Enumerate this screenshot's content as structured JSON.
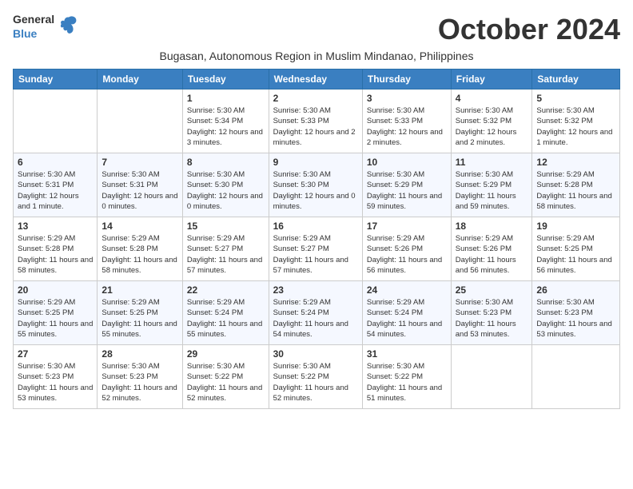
{
  "logo": {
    "general": "General",
    "blue": "Blue"
  },
  "title": "October 2024",
  "subtitle": "Bugasan, Autonomous Region in Muslim Mindanao, Philippines",
  "days_of_week": [
    "Sunday",
    "Monday",
    "Tuesday",
    "Wednesday",
    "Thursday",
    "Friday",
    "Saturday"
  ],
  "weeks": [
    [
      {
        "day": null,
        "info": null
      },
      {
        "day": null,
        "info": null
      },
      {
        "day": "1",
        "sunrise": "5:30 AM",
        "sunset": "5:34 PM",
        "daylight": "12 hours and 3 minutes."
      },
      {
        "day": "2",
        "sunrise": "5:30 AM",
        "sunset": "5:33 PM",
        "daylight": "12 hours and 2 minutes."
      },
      {
        "day": "3",
        "sunrise": "5:30 AM",
        "sunset": "5:33 PM",
        "daylight": "12 hours and 2 minutes."
      },
      {
        "day": "4",
        "sunrise": "5:30 AM",
        "sunset": "5:32 PM",
        "daylight": "12 hours and 2 minutes."
      },
      {
        "day": "5",
        "sunrise": "5:30 AM",
        "sunset": "5:32 PM",
        "daylight": "12 hours and 1 minute."
      }
    ],
    [
      {
        "day": "6",
        "sunrise": "5:30 AM",
        "sunset": "5:31 PM",
        "daylight": "12 hours and 1 minute."
      },
      {
        "day": "7",
        "sunrise": "5:30 AM",
        "sunset": "5:31 PM",
        "daylight": "12 hours and 0 minutes."
      },
      {
        "day": "8",
        "sunrise": "5:30 AM",
        "sunset": "5:30 PM",
        "daylight": "12 hours and 0 minutes."
      },
      {
        "day": "9",
        "sunrise": "5:30 AM",
        "sunset": "5:30 PM",
        "daylight": "12 hours and 0 minutes."
      },
      {
        "day": "10",
        "sunrise": "5:30 AM",
        "sunset": "5:29 PM",
        "daylight": "11 hours and 59 minutes."
      },
      {
        "day": "11",
        "sunrise": "5:30 AM",
        "sunset": "5:29 PM",
        "daylight": "11 hours and 59 minutes."
      },
      {
        "day": "12",
        "sunrise": "5:29 AM",
        "sunset": "5:28 PM",
        "daylight": "11 hours and 58 minutes."
      }
    ],
    [
      {
        "day": "13",
        "sunrise": "5:29 AM",
        "sunset": "5:28 PM",
        "daylight": "11 hours and 58 minutes."
      },
      {
        "day": "14",
        "sunrise": "5:29 AM",
        "sunset": "5:28 PM",
        "daylight": "11 hours and 58 minutes."
      },
      {
        "day": "15",
        "sunrise": "5:29 AM",
        "sunset": "5:27 PM",
        "daylight": "11 hours and 57 minutes."
      },
      {
        "day": "16",
        "sunrise": "5:29 AM",
        "sunset": "5:27 PM",
        "daylight": "11 hours and 57 minutes."
      },
      {
        "day": "17",
        "sunrise": "5:29 AM",
        "sunset": "5:26 PM",
        "daylight": "11 hours and 56 minutes."
      },
      {
        "day": "18",
        "sunrise": "5:29 AM",
        "sunset": "5:26 PM",
        "daylight": "11 hours and 56 minutes."
      },
      {
        "day": "19",
        "sunrise": "5:29 AM",
        "sunset": "5:25 PM",
        "daylight": "11 hours and 56 minutes."
      }
    ],
    [
      {
        "day": "20",
        "sunrise": "5:29 AM",
        "sunset": "5:25 PM",
        "daylight": "11 hours and 55 minutes."
      },
      {
        "day": "21",
        "sunrise": "5:29 AM",
        "sunset": "5:25 PM",
        "daylight": "11 hours and 55 minutes."
      },
      {
        "day": "22",
        "sunrise": "5:29 AM",
        "sunset": "5:24 PM",
        "daylight": "11 hours and 55 minutes."
      },
      {
        "day": "23",
        "sunrise": "5:29 AM",
        "sunset": "5:24 PM",
        "daylight": "11 hours and 54 minutes."
      },
      {
        "day": "24",
        "sunrise": "5:29 AM",
        "sunset": "5:24 PM",
        "daylight": "11 hours and 54 minutes."
      },
      {
        "day": "25",
        "sunrise": "5:30 AM",
        "sunset": "5:23 PM",
        "daylight": "11 hours and 53 minutes."
      },
      {
        "day": "26",
        "sunrise": "5:30 AM",
        "sunset": "5:23 PM",
        "daylight": "11 hours and 53 minutes."
      }
    ],
    [
      {
        "day": "27",
        "sunrise": "5:30 AM",
        "sunset": "5:23 PM",
        "daylight": "11 hours and 53 minutes."
      },
      {
        "day": "28",
        "sunrise": "5:30 AM",
        "sunset": "5:23 PM",
        "daylight": "11 hours and 52 minutes."
      },
      {
        "day": "29",
        "sunrise": "5:30 AM",
        "sunset": "5:22 PM",
        "daylight": "11 hours and 52 minutes."
      },
      {
        "day": "30",
        "sunrise": "5:30 AM",
        "sunset": "5:22 PM",
        "daylight": "11 hours and 52 minutes."
      },
      {
        "day": "31",
        "sunrise": "5:30 AM",
        "sunset": "5:22 PM",
        "daylight": "11 hours and 51 minutes."
      },
      {
        "day": null,
        "info": null
      },
      {
        "day": null,
        "info": null
      }
    ]
  ]
}
